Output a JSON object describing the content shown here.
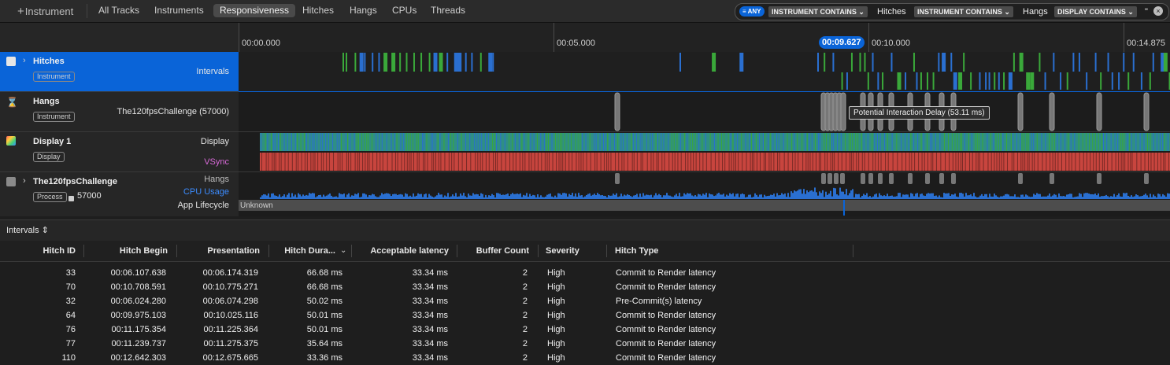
{
  "toolbar": {
    "add_instrument_label": "Instrument",
    "tabs": [
      {
        "label": "All Tracks"
      },
      {
        "label": "Instruments"
      },
      {
        "label": "Responsiveness"
      },
      {
        "label": "Hitches"
      },
      {
        "label": "Hangs"
      },
      {
        "label": "CPUs"
      },
      {
        "label": "Threads"
      }
    ],
    "active_tab": "Responsiveness"
  },
  "filter": {
    "match_mode": "ANY",
    "tokens": [
      {
        "field": "INSTRUMENT CONTAINS",
        "value": "Hitches"
      },
      {
        "field": "INSTRUMENT CONTAINS",
        "value": "Hangs"
      },
      {
        "field": "DISPLAY CONTAINS",
        "value": "\""
      }
    ]
  },
  "timeline": {
    "ticks": [
      "00:00.000",
      "00:05.000",
      "00:10.000",
      "00:14.875"
    ],
    "playhead": "00:09.627",
    "tooltip": "Potential Interaction Delay (53.11 ms)"
  },
  "tracks": {
    "hitches": {
      "title": "Hitches",
      "badge": "Instrument",
      "lane": "Intervals"
    },
    "hangs": {
      "title": "Hangs",
      "badge": "Instrument",
      "lane": "The120fpsChallenge (57000)"
    },
    "display": {
      "title": "Display 1",
      "badge": "Display",
      "lane_display": "Display",
      "lane_vsync": "VSync"
    },
    "process": {
      "title": "The120fpsChallenge",
      "badge": "Process",
      "pid": "57000",
      "lane_hangs": "Hangs",
      "lane_cpu": "CPU Usage",
      "lane_lifecycle": "App Lifecycle",
      "lifecycle_state": "Unknown"
    }
  },
  "colors": {
    "accent": "#0a64d8",
    "hitch_green": "#3aa83a",
    "hitch_blue": "#2a6fd0",
    "vsync_red": "#c8453e",
    "display_teal": "#2f8f84"
  },
  "table": {
    "selector_label": "Intervals",
    "columns": [
      "Hitch ID",
      "Hitch Begin",
      "Presentation",
      "Hitch Dura...",
      "Acceptable latency",
      "Buffer Count",
      "Severity",
      "Hitch Type"
    ],
    "rows": [
      [
        "33",
        "00:06.107.638",
        "00:06.174.319",
        "66.68 ms",
        "33.34 ms",
        "2",
        "High",
        "Commit to Render latency"
      ],
      [
        "70",
        "00:10.708.591",
        "00:10.775.271",
        "66.68 ms",
        "33.34 ms",
        "2",
        "High",
        "Commit to Render latency"
      ],
      [
        "32",
        "00:06.024.280",
        "00:06.074.298",
        "50.02 ms",
        "33.34 ms",
        "2",
        "High",
        "Pre-Commit(s) latency"
      ],
      [
        "64",
        "00:09.975.103",
        "00:10.025.116",
        "50.01 ms",
        "33.34 ms",
        "2",
        "High",
        "Commit to Render latency"
      ],
      [
        "76",
        "00:11.175.354",
        "00:11.225.364",
        "50.01 ms",
        "33.34 ms",
        "2",
        "High",
        "Commit to Render latency"
      ],
      [
        "77",
        "00:11.239.737",
        "00:11.275.375",
        "35.64 ms",
        "33.34 ms",
        "2",
        "High",
        "Commit to Render latency"
      ],
      [
        "110",
        "00:12.642.303",
        "00:12.675.665",
        "33.36 ms",
        "33.34 ms",
        "2",
        "High",
        "Commit to Render latency"
      ]
    ]
  }
}
